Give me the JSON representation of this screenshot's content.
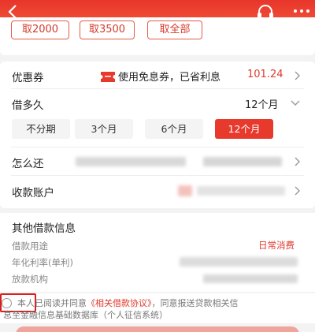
{
  "colors": {
    "brand_red": "#e8392d",
    "text": "#222222",
    "muted": "#888888"
  },
  "header": {
    "back_icon": "chevron-left-icon",
    "service_icon": "headset-icon",
    "more_icon": "more-dots-icon"
  },
  "amount": {
    "quick_options": [
      "取2000",
      "取3500",
      "取全部"
    ]
  },
  "coupon": {
    "label": "优惠券",
    "icon": "ticket-icon",
    "text": "使用免息券，已省利息",
    "amount": "101.24"
  },
  "term": {
    "label": "借多久",
    "selected": "12个月",
    "options": [
      "不分期",
      "3个月",
      "6个月",
      "12个月"
    ],
    "active_index": 3
  },
  "repay": {
    "label": "怎么还"
  },
  "account": {
    "label": "收款账户"
  },
  "other_info": {
    "title": "其他借款信息",
    "purpose_label": "借款用途",
    "purpose_value": "日常消费",
    "rate_label": "年化利率(单利)",
    "lender_label": "放款机构"
  },
  "agreement": {
    "part1": "本人已阅读并同意",
    "link": "《相关借款协议》",
    "part2": "，同意报送贷款相关信",
    "line2": "息至金融信息基础数据库（个人征信系统）"
  }
}
